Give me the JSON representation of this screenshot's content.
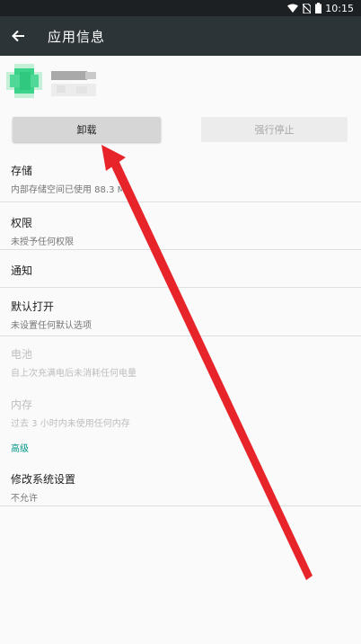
{
  "status_bar": {
    "time": "10:15",
    "icons": [
      "wifi-icon",
      "no-sim-icon",
      "battery-icon"
    ]
  },
  "toolbar": {
    "back_icon": "arrow-left-icon",
    "title": "应用信息"
  },
  "app": {
    "icon": "blurred-app-icon",
    "name_visible": false
  },
  "buttons": {
    "uninstall": "卸载",
    "force_stop": "强行停止",
    "force_stop_enabled": false
  },
  "rows": {
    "storage": {
      "title": "存储",
      "subtitle": "内部存储空间已使用 88.3 MB"
    },
    "permissions": {
      "title": "权限",
      "subtitle": "未授予任何权限"
    },
    "notifications": {
      "title": "通知"
    },
    "default_open": {
      "title": "默认打开",
      "subtitle": "未设置任何默认选项"
    },
    "battery": {
      "title": "电池",
      "subtitle": "自上次充满电后未消耗任何电量"
    },
    "memory": {
      "title": "内存",
      "subtitle": "过去 3 小时内未使用任何内存"
    }
  },
  "section_advanced": "高级",
  "modify_settings": {
    "title": "修改系统设置",
    "subtitle": "不允许"
  },
  "colors": {
    "toolbar": "#2c3438",
    "accent": "#009688",
    "annotation_arrow": "#e8242b"
  }
}
